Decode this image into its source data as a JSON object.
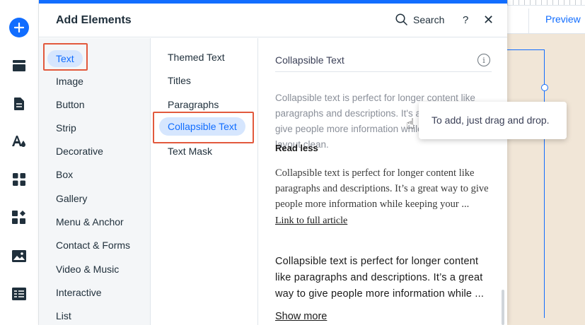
{
  "panel": {
    "title": "Add Elements",
    "search_label": "Search",
    "help_label": "?",
    "close_label": "✕"
  },
  "canvas": {
    "preview_label": "Preview"
  },
  "categories": [
    {
      "label": "Text",
      "selected": true
    },
    {
      "label": "Image"
    },
    {
      "label": "Button"
    },
    {
      "label": "Strip"
    },
    {
      "label": "Decorative"
    },
    {
      "label": "Box"
    },
    {
      "label": "Gallery"
    },
    {
      "label": "Menu & Anchor"
    },
    {
      "label": "Contact & Forms"
    },
    {
      "label": "Video & Music"
    },
    {
      "label": "Interactive"
    },
    {
      "label": "List"
    }
  ],
  "subcategories": [
    {
      "label": "Themed Text"
    },
    {
      "label": "Titles"
    },
    {
      "label": "Paragraphs"
    },
    {
      "label": "Collapsible Text",
      "selected": true
    },
    {
      "label": "Text Mask"
    }
  ],
  "preview": {
    "heading": "Collapsible Text",
    "info_glyph": "i",
    "sample1_text": "Collapsible text is perfect for longer content like paragraphs and descriptions. It's a great way to give people more information while keeping your layout clean.",
    "sample1_action": "Read less",
    "sample2_text": "Collapsible text is perfect for longer content like paragraphs and descriptions. It’s a great way to give people more information while keeping your ...",
    "sample2_action": "Link to full article",
    "sample3_text": "Collapsible text is perfect for longer content like paragraphs and descriptions. It’s a great way to give people more information while ...",
    "sample3_action": "Show more"
  },
  "tooltip": {
    "text": "To add, just drag and drop."
  },
  "colors": {
    "accent": "#116dff",
    "highlight": "#e2593d",
    "selected_bg": "#d6e6fe"
  },
  "icons": [
    "add-icon",
    "menu-icon",
    "pages-icon",
    "design-icon",
    "apps-icon",
    "app-market-icon",
    "media-icon",
    "cms-icon",
    "search-icon",
    "help-icon",
    "close-icon",
    "info-icon",
    "hand-cursor-icon"
  ]
}
